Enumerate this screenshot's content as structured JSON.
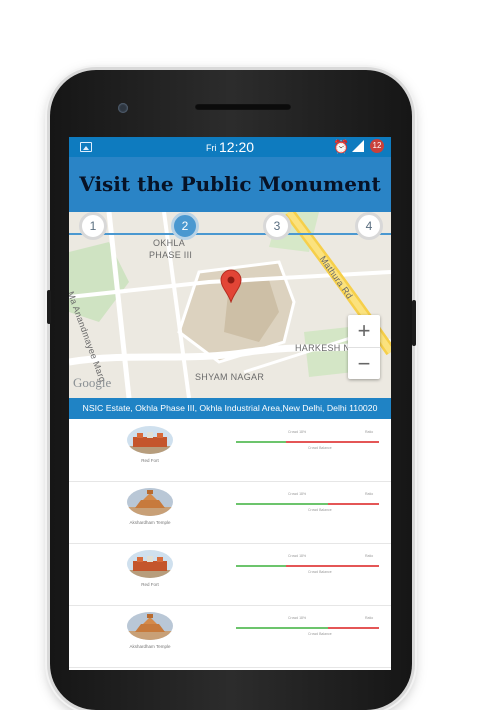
{
  "status_bar": {
    "day": "Fri",
    "time": "12:20",
    "battery_badge": "12"
  },
  "title": "Visit the Public Monument",
  "map": {
    "steps": [
      "1",
      "2",
      "3",
      "4"
    ],
    "active_step": "2",
    "labels": {
      "area1": "OKHLA",
      "area2": "PHASE III",
      "road1": "Mathura Rd",
      "road2": "Ma Anandmayee Marg",
      "area3": "HARKESH NAGAR",
      "area4": "SHYAM NAGAR"
    },
    "zoom_in": "+",
    "zoom_out": "−",
    "attribution": "Google"
  },
  "address": "NSIC Estate, Okhla Phase III, Okhla Industrial Area,New Delhi, Delhi 110020",
  "list": {
    "bar_label_left": "Crowd 18%",
    "bar_label_right": "Ratio",
    "bar_label_bottom": "Crowd Balance",
    "items": [
      {
        "name": "Red Fort",
        "green": 0.35,
        "red": 0.65
      },
      {
        "name": "Akshardham Temple",
        "green": 0.64,
        "red": 0.36
      },
      {
        "name": "Red Fort",
        "green": 0.35,
        "red": 0.65
      },
      {
        "name": "Akshardham Temple",
        "green": 0.64,
        "red": 0.36
      }
    ]
  },
  "colors": {
    "status_bar": "#0e7bbf",
    "title_bar": "#2a84c6",
    "accent": "#1f83c5",
    "marker": "#e24536"
  }
}
